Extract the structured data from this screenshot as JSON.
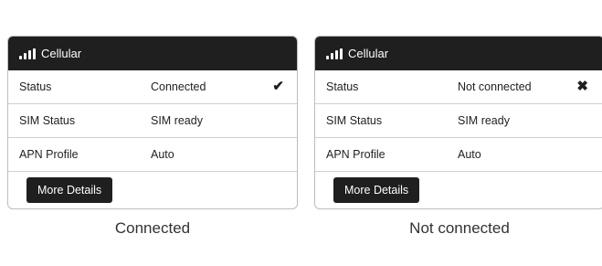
{
  "cards": [
    {
      "header": {
        "title": "Cellular",
        "icon": "signal-bars-icon"
      },
      "rows": [
        {
          "key": "Status",
          "value": "Connected",
          "mark": "✔",
          "mark_icon": "checkmark-icon"
        },
        {
          "key": "SIM Status",
          "value": "SIM ready"
        },
        {
          "key": "APN Profile",
          "value": "Auto"
        }
      ],
      "button_label": "More Details",
      "caption": "Connected"
    },
    {
      "header": {
        "title": "Cellular",
        "icon": "signal-bars-icon"
      },
      "rows": [
        {
          "key": "Status",
          "value": "Not connected",
          "mark": "✖",
          "mark_icon": "x-mark-icon"
        },
        {
          "key": "SIM Status",
          "value": "SIM ready"
        },
        {
          "key": "APN Profile",
          "value": "Auto"
        }
      ],
      "button_label": "More Details",
      "caption": "Not connected"
    }
  ],
  "colors": {
    "header_bg": "#1f1f1f",
    "header_text": "#ffffff",
    "border": "#bdbdbd"
  }
}
